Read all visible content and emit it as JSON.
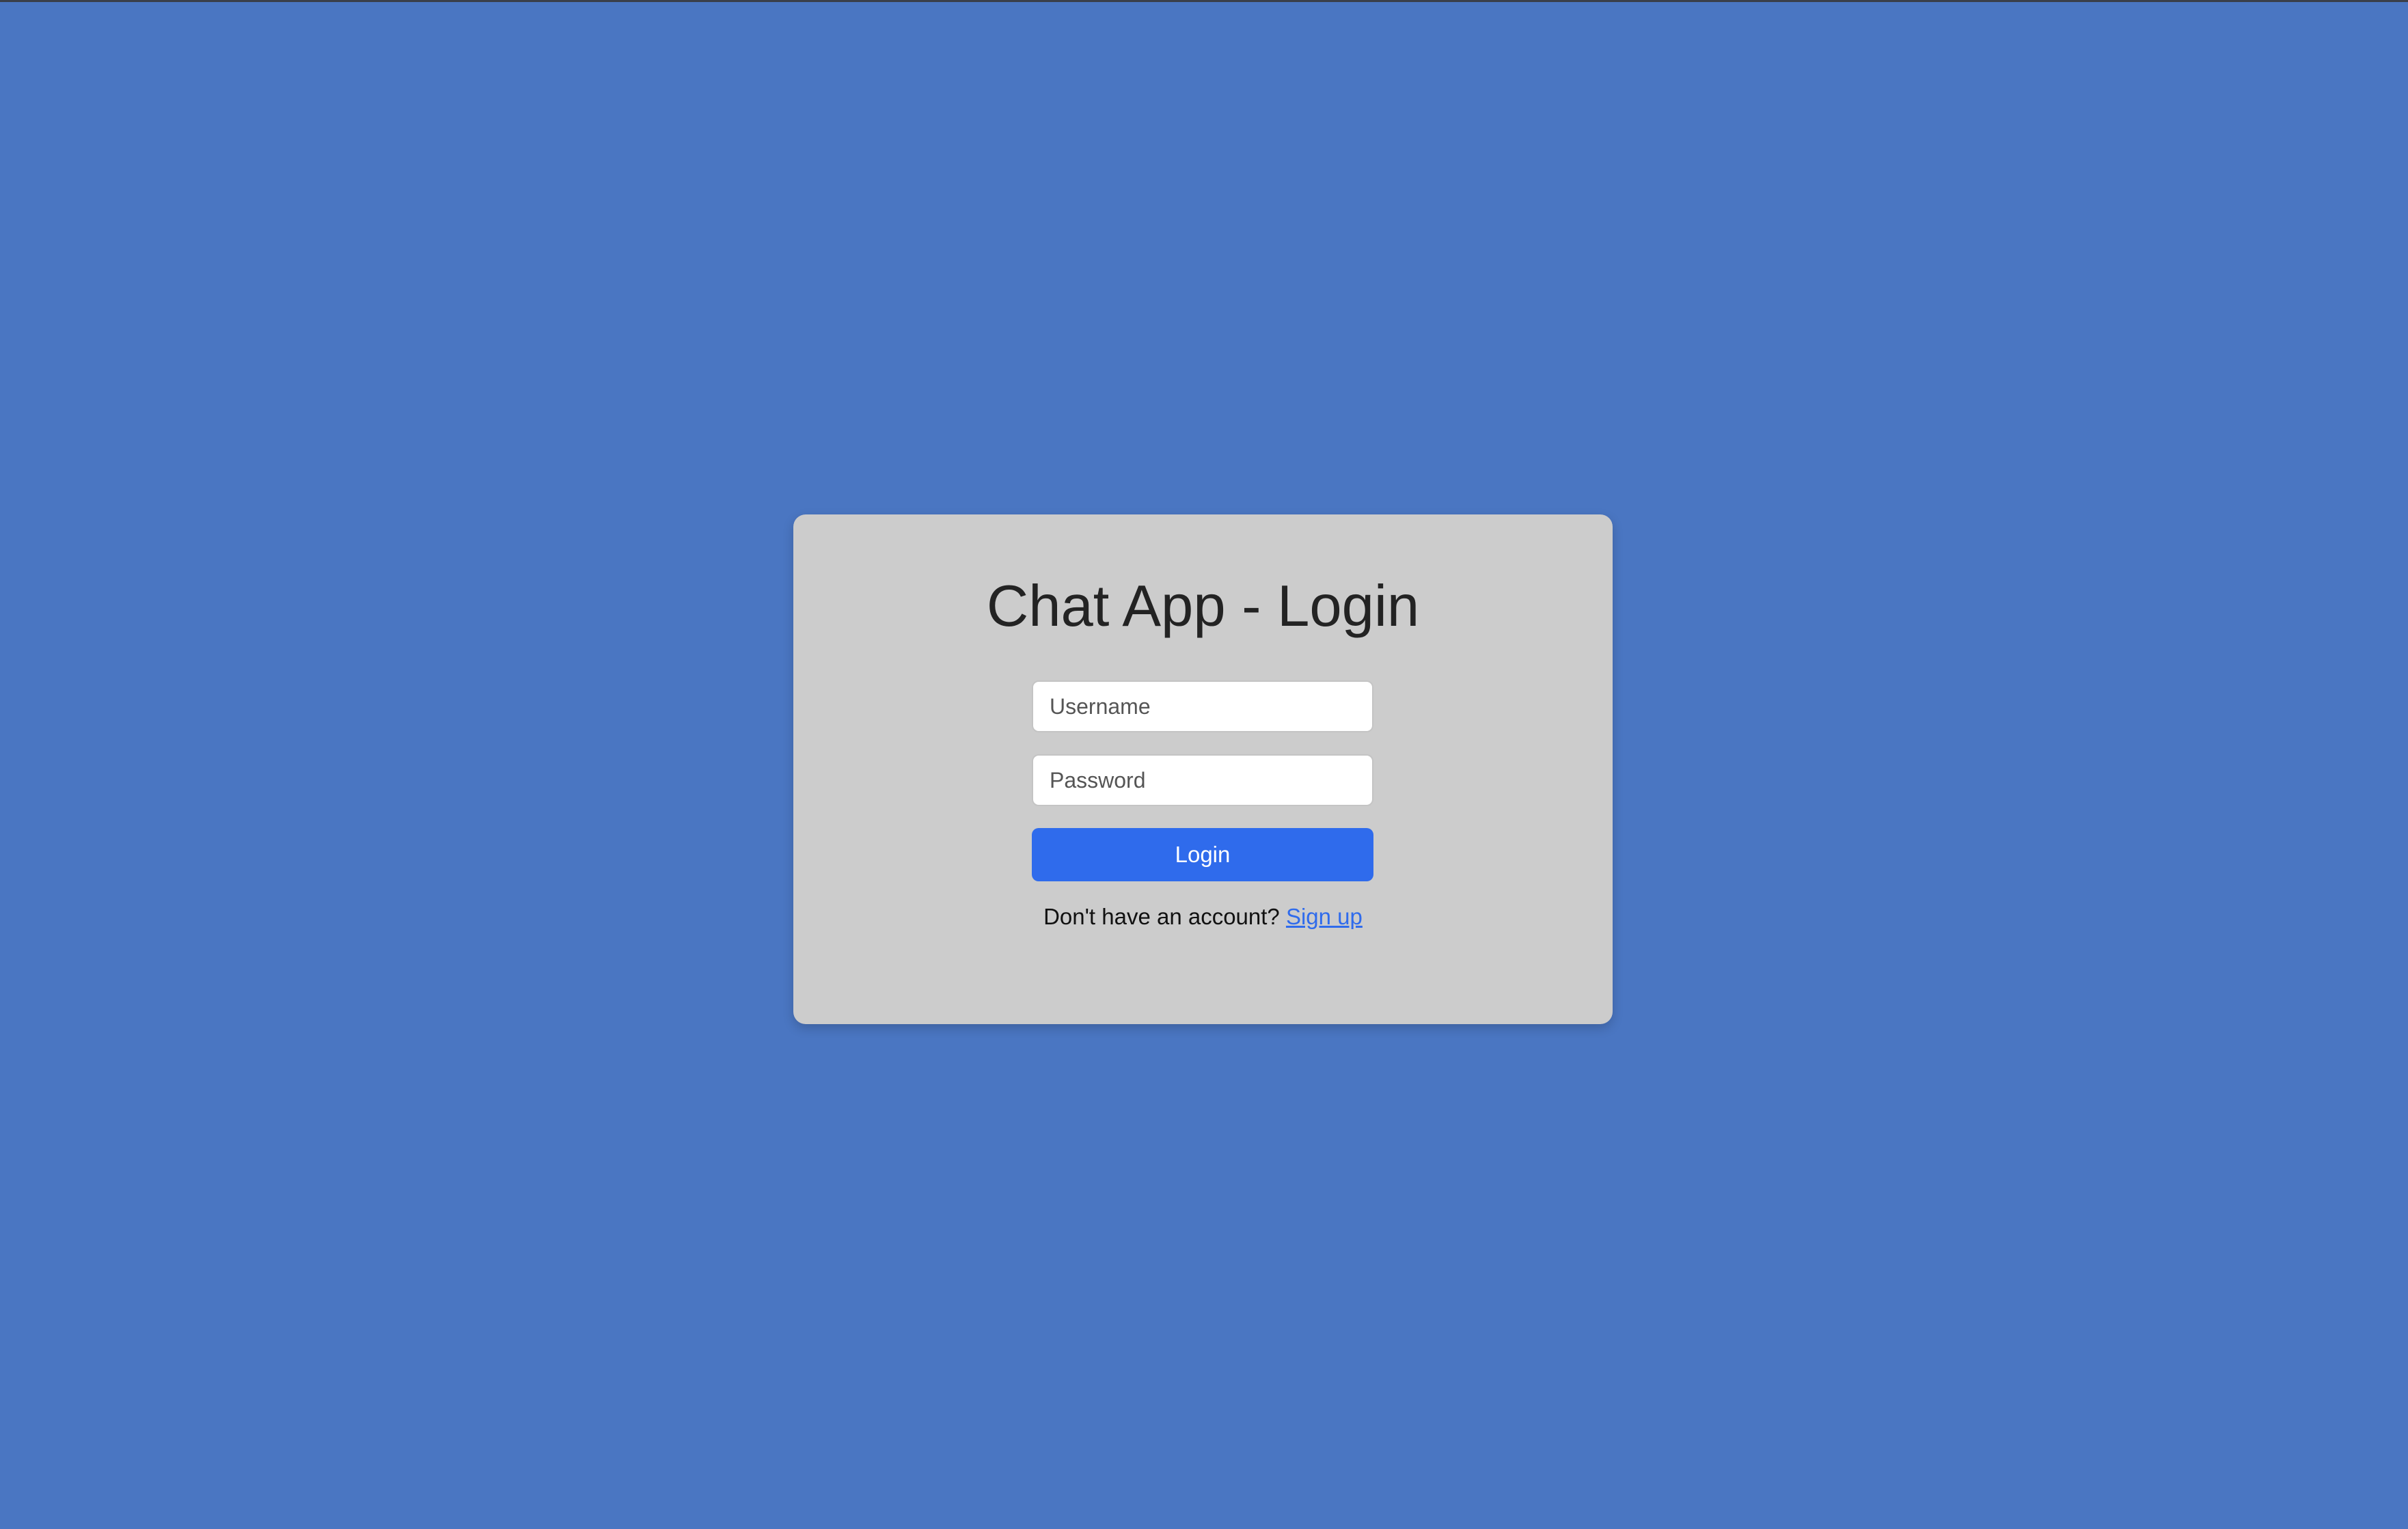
{
  "theme": {
    "page_background": "#4a76c2",
    "card_background": "#cccccc",
    "accent": "#2f6bec",
    "title_color": "#232323"
  },
  "login_card": {
    "title": "Chat App - Login",
    "username_placeholder": "Username",
    "password_placeholder": "Password",
    "login_label": "Login",
    "signup_prompt": "Don't have an account?",
    "signup_link": "Sign up"
  }
}
